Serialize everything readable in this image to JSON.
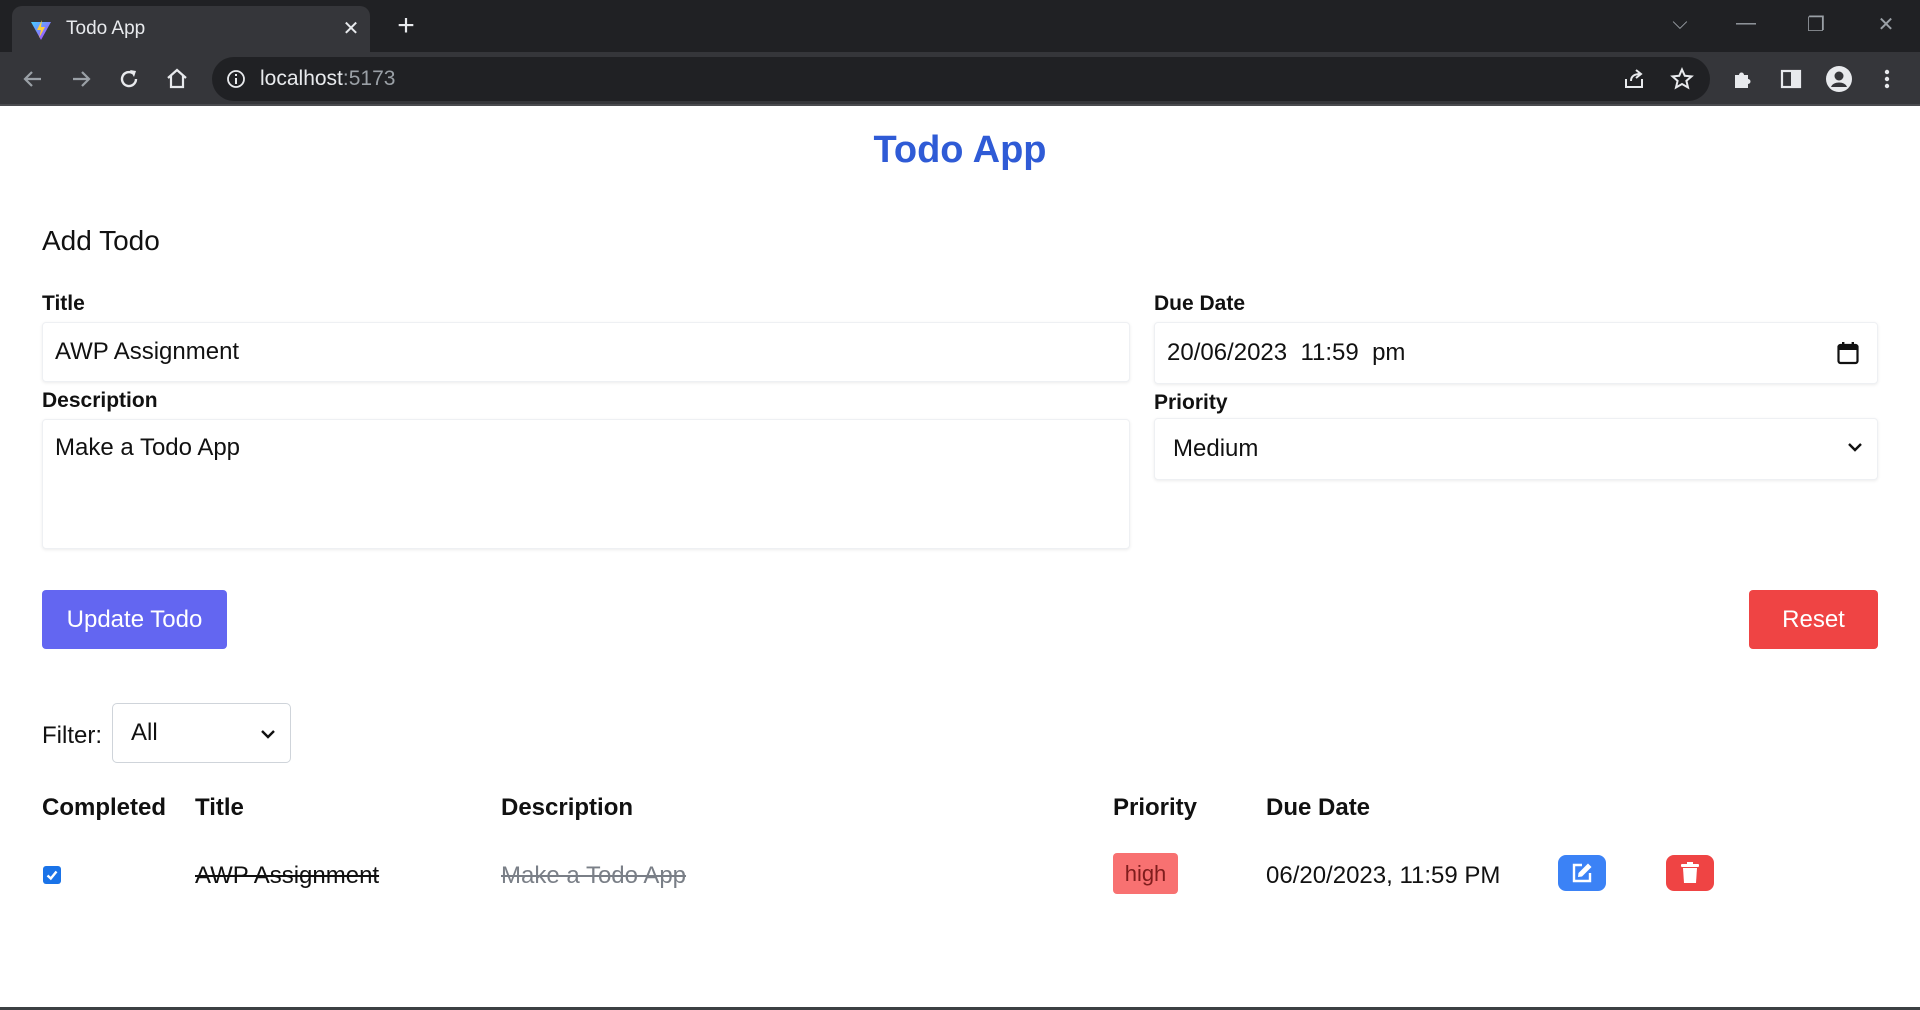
{
  "browser": {
    "tab_title": "Todo App",
    "url_host": "localhost",
    "url_port": ":5173"
  },
  "app": {
    "title": "Todo App",
    "form": {
      "heading": "Add Todo",
      "title_label": "Title",
      "title_value": "AWP Assignment",
      "description_label": "Description",
      "description_value": "Make a Todo App",
      "due_date_label": "Due Date",
      "due_date_value": "20/06/2023  11:59  pm",
      "priority_label": "Priority",
      "priority_value": "Medium",
      "update_button": "Update Todo",
      "reset_button": "Reset"
    },
    "filter": {
      "label": "Filter:",
      "value": "All"
    },
    "table": {
      "headers": [
        "Completed",
        "Title",
        "Description",
        "Priority",
        "Due Date"
      ],
      "rows": [
        {
          "completed": true,
          "title": "AWP Assignment",
          "description": "Make a Todo App",
          "priority": "high",
          "due_date": "06/20/2023, 11:59 PM"
        }
      ]
    }
  },
  "colors": {
    "title_blue": "#2f5bd6",
    "update_button": "#6366f1",
    "reset_button": "#ef4444",
    "priority_high_badge": "#f87171",
    "edit_button": "#3b82f6",
    "delete_button": "#ef4444"
  },
  "icons": {
    "tab_favicon": "vite-logo-icon",
    "tab_close": "close-icon",
    "new_tab": "plus-icon",
    "back": "arrow-left-icon",
    "forward": "arrow-right-icon",
    "reload": "reload-icon",
    "home": "home-icon",
    "site_info": "info-icon",
    "share": "share-icon",
    "bookmark": "star-icon",
    "extensions": "puzzle-icon",
    "side_panel": "side-panel-icon",
    "profile": "profile-icon",
    "menu": "kebab-menu-icon",
    "calendar": "calendar-icon",
    "edit": "edit-icon",
    "delete": "trash-icon"
  }
}
